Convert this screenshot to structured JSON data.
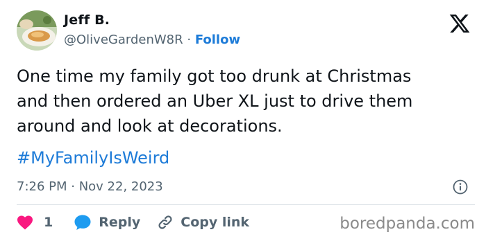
{
  "author": {
    "name": "Jeff B.",
    "handle": "@OliveGardenW8R",
    "separator": "·",
    "follow_label": "Follow",
    "avatar_icon": "food-plate-avatar"
  },
  "platform_icon": "x-logo-icon",
  "tweet": {
    "lines": [
      "One time my family got too drunk at Christmas",
      "and then ordered an Uber XL just to drive them",
      "around and look at decorations."
    ],
    "hashtag": "#MyFamilyIsWeird"
  },
  "timestamp": "7:26 PM · Nov 22, 2023",
  "actions": {
    "like_count": "1",
    "reply_label": "Reply",
    "copy_link_label": "Copy link"
  },
  "watermark": "boredpanda.com",
  "colors": {
    "link_blue": "#1d7bd8",
    "heart_pink": "#f91880",
    "reply_blue": "#1d9bf0",
    "muted_gray": "#536471"
  }
}
